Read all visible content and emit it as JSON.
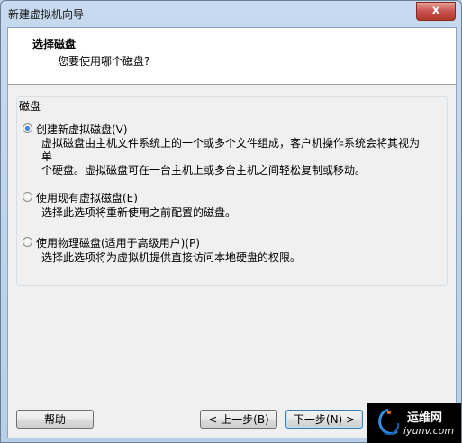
{
  "window": {
    "title": "新建虚拟机向导",
    "close_glyph": "x"
  },
  "header": {
    "title": "选择磁盘",
    "subtitle": "您要使用哪个磁盘?"
  },
  "group": {
    "label": "磁盘",
    "options": [
      {
        "label": "创建新虚拟磁盘(V)",
        "checked": true,
        "description_lines": [
          "虚拟磁盘由主机文件系统上的一个或多个文件组成，客户机操作系统会将其视为单",
          "个硬盘。虚拟磁盘可在一台主机上或多台主机之间轻松复制或移动。"
        ]
      },
      {
        "label": "使用现有虚拟磁盘(E)",
        "checked": false,
        "description_lines": [
          "选择此选项将重新使用之前配置的磁盘。"
        ]
      },
      {
        "label": "使用物理磁盘(适用于高级用户)(P)",
        "checked": false,
        "description_lines": [
          "选择此选项将为虚拟机提供直接访问本地硬盘的权限。"
        ]
      }
    ]
  },
  "buttons": {
    "help": "帮助",
    "back": "< 上一步(B)",
    "next": "下一步(N) >"
  },
  "watermark": {
    "name": "运维网",
    "url": "iyunv.com"
  },
  "colors": {
    "title_bar": "#c7daef",
    "client_bg": "#f0f0f0",
    "close_button": "#c75050",
    "radio_selected": "#1a56a8"
  }
}
